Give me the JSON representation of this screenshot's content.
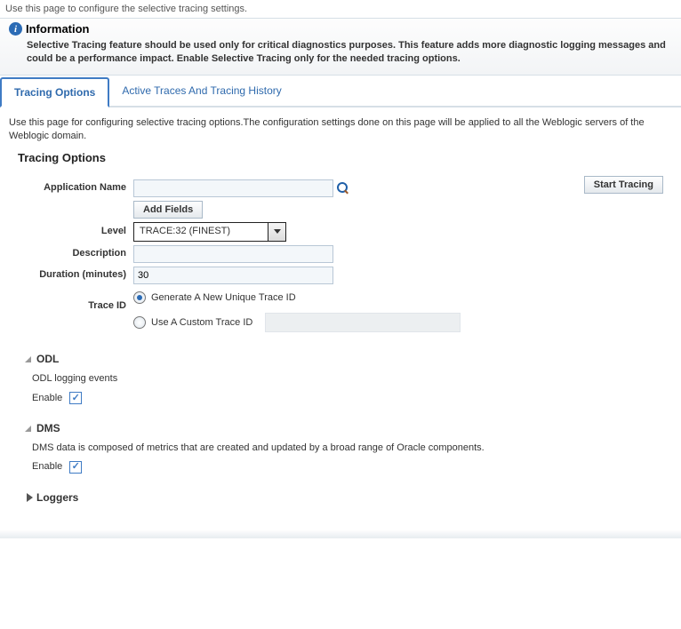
{
  "topDescription": "Use this page to configure the selective tracing settings.",
  "info": {
    "iconGlyph": "i",
    "title": "Information",
    "message": "Selective Tracing feature should be used only for critical diagnostics purposes. This feature adds more diagnostic logging messages and could be a performance impact. Enable Selective Tracing only for the needed tracing options."
  },
  "tabs": {
    "options": "Tracing Options",
    "history": "Active Traces And Tracing History"
  },
  "intro": "Use this page for configuring selective tracing options.The configuration settings done on this page will be applied to all the Weblogic servers of the Weblogic domain.",
  "sectionTitle": "Tracing Options",
  "startTracing": "Start Tracing",
  "labels": {
    "appName": "Application Name",
    "addFields": "Add Fields",
    "level": "Level",
    "description": "Description",
    "duration": "Duration (minutes)",
    "traceId": "Trace ID"
  },
  "values": {
    "appName": "",
    "level": "TRACE:32 (FINEST)",
    "description": "",
    "duration": "30",
    "radioGenerate": "Generate A New Unique Trace ID",
    "radioCustom": "Use A Custom Trace ID"
  },
  "odl": {
    "title": "ODL",
    "desc": "ODL logging events",
    "enableLabel": "Enable"
  },
  "dms": {
    "title": "DMS",
    "desc": "DMS data is composed of metrics that are created and updated by a broad range of Oracle components.",
    "enableLabel": "Enable"
  },
  "loggers": {
    "title": "Loggers"
  }
}
